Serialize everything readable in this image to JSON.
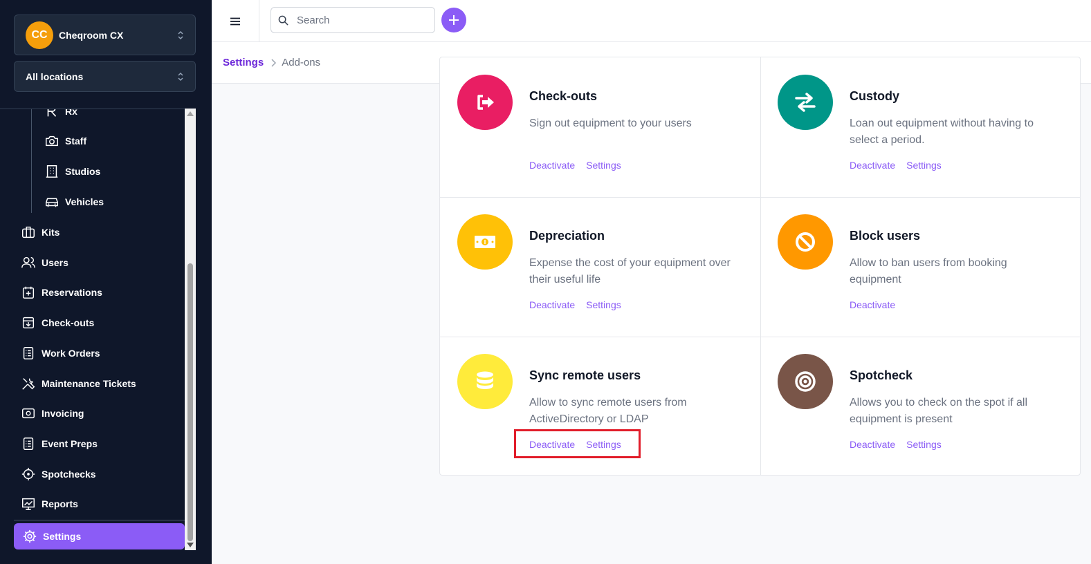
{
  "org": {
    "initials": "CC",
    "name": "Cheqroom CX"
  },
  "location": {
    "label": "All locations"
  },
  "sidebar": {
    "sub_items": [
      {
        "label": "Rx",
        "icon": "rx-icon"
      },
      {
        "label": "Staff",
        "icon": "camera-icon"
      },
      {
        "label": "Studios",
        "icon": "building-icon"
      },
      {
        "label": "Vehicles",
        "icon": "car-icon"
      }
    ],
    "items": [
      {
        "label": "Kits",
        "icon": "briefcase-icon"
      },
      {
        "label": "Users",
        "icon": "users-icon"
      },
      {
        "label": "Reservations",
        "icon": "calendar-plus-icon"
      },
      {
        "label": "Check-outs",
        "icon": "inbox-download-icon"
      },
      {
        "label": "Work Orders",
        "icon": "clipboard-list-icon"
      },
      {
        "label": "Maintenance Tickets",
        "icon": "tools-icon"
      },
      {
        "label": "Invoicing",
        "icon": "cash-icon"
      },
      {
        "label": "Event Preps",
        "icon": "checklist-icon"
      },
      {
        "label": "Spotchecks",
        "icon": "crosshair-icon"
      },
      {
        "label": "Reports",
        "icon": "chart-icon"
      }
    ],
    "active": {
      "label": "Settings",
      "icon": "gear-icon"
    }
  },
  "search": {
    "placeholder": "Search"
  },
  "breadcrumb": {
    "link": "Settings",
    "current": "Add-ons"
  },
  "addons": [
    {
      "title": "Check-outs",
      "desc": "Sign out equipment to your users",
      "color": "#e91e63",
      "icon": "sign-out-icon",
      "actions": [
        "Deactivate",
        "Settings"
      ]
    },
    {
      "title": "Custody",
      "desc": "Loan out equipment without having to select a period.",
      "color": "#009688",
      "icon": "exchange-icon",
      "actions": [
        "Deactivate",
        "Settings"
      ]
    },
    {
      "title": "Depreciation",
      "desc": "Expense the cost of your equipment over their useful life",
      "color": "#ffc107",
      "icon": "money-icon",
      "actions": [
        "Deactivate",
        "Settings"
      ]
    },
    {
      "title": "Block users",
      "desc": "Allow to ban users from booking equipment",
      "color": "#ff9800",
      "icon": "ban-icon",
      "actions": [
        "Deactivate"
      ]
    },
    {
      "title": "Sync remote users",
      "desc": "Allow to sync remote users from ActiveDirectory or LDAP",
      "color": "#ffeb3b",
      "icon": "database-icon",
      "actions": [
        "Deactivate",
        "Settings"
      ]
    },
    {
      "title": "Spotcheck",
      "desc": "Allows you to check on the spot if all equipment is present",
      "color": "#795548",
      "icon": "target-icon",
      "actions": [
        "Deactivate",
        "Settings"
      ]
    }
  ]
}
